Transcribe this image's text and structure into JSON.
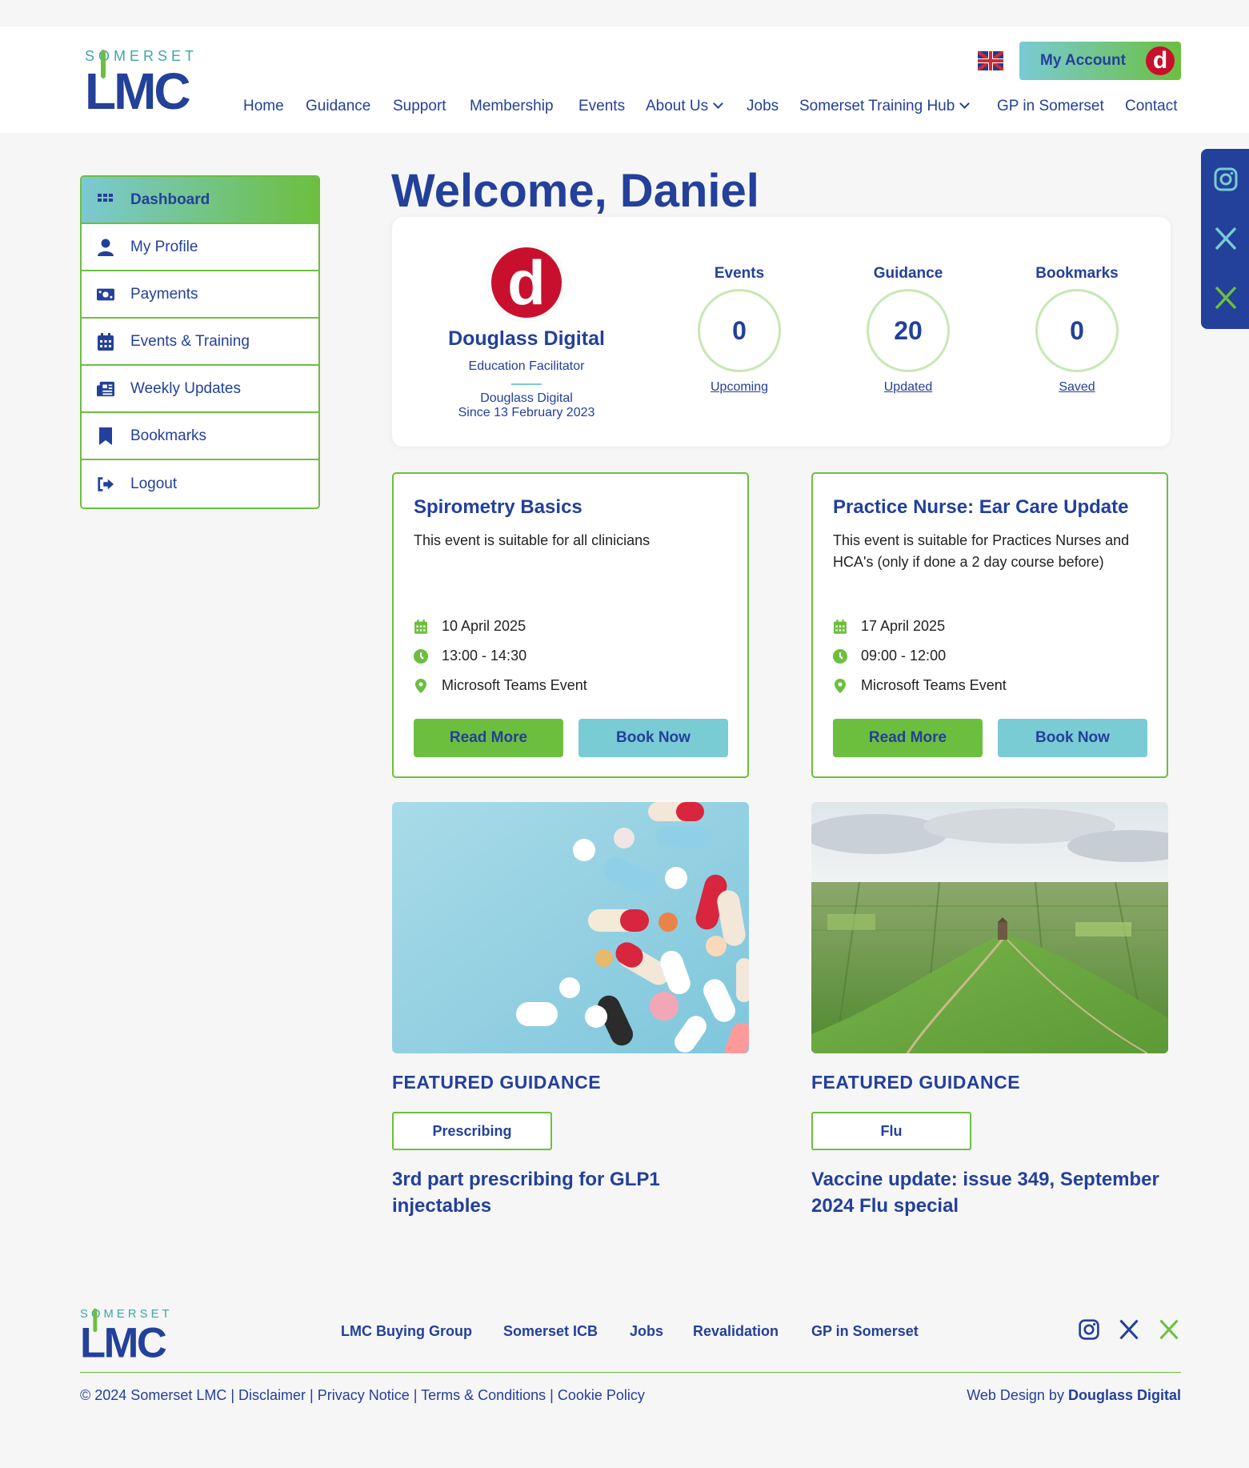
{
  "brand": {
    "logo_small": "SOMERSET",
    "logo_big": "LMC"
  },
  "nav": {
    "items": [
      "Home",
      "Guidance",
      "Support",
      "Membership",
      "Events",
      "About Us",
      "Jobs",
      "Somerset Training Hub",
      "GP in Somerset",
      "Contact"
    ],
    "language_icon": "uk-flag-icon",
    "account_label": "My Account",
    "account_avatar": "d"
  },
  "sidebar": {
    "items": [
      {
        "label": "Dashboard",
        "icon": "grid-icon"
      },
      {
        "label": "My Profile",
        "icon": "user-icon"
      },
      {
        "label": "Payments",
        "icon": "money-icon"
      },
      {
        "label": "Events & Training",
        "icon": "calendar-icon"
      },
      {
        "label": "Weekly Updates",
        "icon": "newspaper-icon"
      },
      {
        "label": "Bookmarks",
        "icon": "bookmark-icon"
      },
      {
        "label": "Logout",
        "icon": "logout-icon"
      }
    ]
  },
  "welcome": {
    "title": "Welcome, Daniel"
  },
  "profile": {
    "avatar_letter": "d",
    "organisation": "Douglass Digital",
    "role": "Education Facilitator",
    "member_org": "Douglass Digital",
    "member_since": "Since 13 February 2023"
  },
  "stats": [
    {
      "label": "Events",
      "value": "0",
      "link": "Upcoming"
    },
    {
      "label": "Guidance",
      "value": "20",
      "link": "Updated"
    },
    {
      "label": "Bookmarks",
      "value": "0",
      "link": "Saved"
    }
  ],
  "events": [
    {
      "title": "Spirometry Basics",
      "description": "This event is suitable for all clinicians",
      "date": "10 April 2025",
      "time": "13:00 - 14:30",
      "location": "Microsoft Teams Event",
      "read_more": "Read More",
      "book_now": "Book Now"
    },
    {
      "title": "Practice Nurse: Ear Care Update",
      "description": "This event is suitable for Practices Nurses and HCA's (only if done a 2 day course before)",
      "date": "17 April 2025",
      "time": "09:00 - 12:00",
      "location": "Microsoft Teams Event",
      "read_more": "Read More",
      "book_now": "Book Now"
    }
  ],
  "featured": [
    {
      "heading": "FEATURED GUIDANCE",
      "tag": "Prescribing",
      "title": "3rd part prescribing for GLP1 injectables",
      "image": "pills-photo"
    },
    {
      "heading": "FEATURED GUIDANCE",
      "tag": "Flu",
      "title": "Vaccine update: issue 349, September 2024 Flu special",
      "image": "glastonbury-tor-photo"
    }
  ],
  "footer": {
    "links": [
      "LMC Buying Group",
      "Somerset ICB",
      "Jobs",
      "Revalidation",
      "GP in Somerset"
    ],
    "copyright": "© 2024 Somerset LMC | Disclaimer | Privacy Notice | Terms & Conditions | Cookie Policy",
    "credit_prefix": "Web Design by",
    "credit_name": "Douglass Digital"
  },
  "social": [
    "instagram-icon",
    "x-icon",
    "x-green-icon"
  ],
  "colors": {
    "navy": "#23409a",
    "green": "#6cbf3e",
    "teal": "#79cbd4",
    "red": "#c8102e"
  }
}
